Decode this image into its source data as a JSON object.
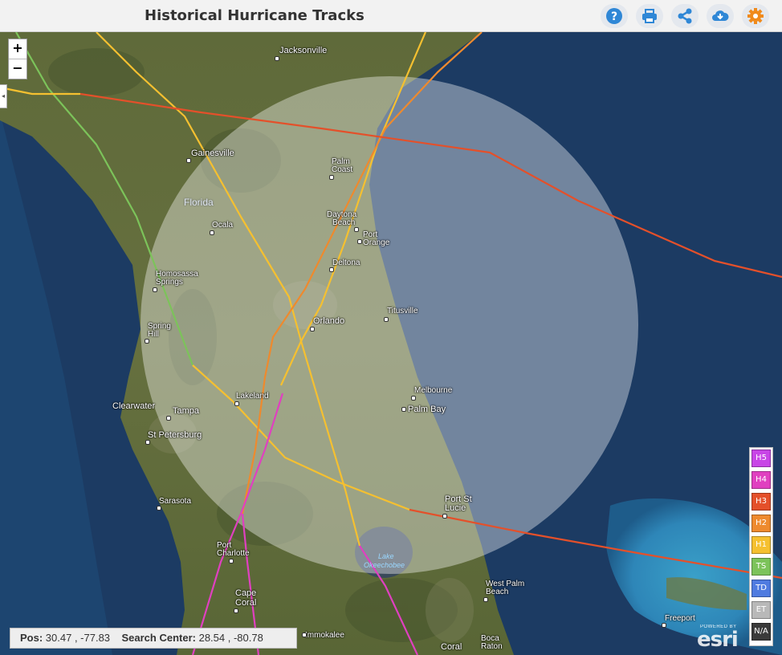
{
  "header": {
    "title": "Historical Hurricane Tracks"
  },
  "toolbar": [
    {
      "name": "help-icon",
      "color": "#2f87d6"
    },
    {
      "name": "print-icon",
      "color": "#2f87d6"
    },
    {
      "name": "share-icon",
      "color": "#2f87d6"
    },
    {
      "name": "download-icon",
      "color": "#2f87d6"
    },
    {
      "name": "gear-icon",
      "color": "#f08a1c"
    }
  ],
  "zoom": {
    "in": "+",
    "out": "−"
  },
  "labels": {
    "jacksonville": "Jacksonville",
    "gainesville": "Gainesville",
    "palm": "Palm",
    "coast": "Coast",
    "florida": "Florida",
    "daytona": "Daytona",
    "beach": "Beach",
    "port": "Port",
    "orange": "Orange",
    "ocala": "Ocala",
    "deltona": "Deltona",
    "homosassa": "Homosassa",
    "springs": "Springs",
    "titusville": "Titusville",
    "spring": "Spring",
    "hill": "Hill",
    "orlando": "Orlando",
    "melbourne": "Melbourne",
    "lakeland": "Lakeland",
    "clearwater": "Clearwater",
    "tampa": "Tampa",
    "palm_bay": "Palm Bay",
    "st_petersburg": "St Petersburg",
    "port_st": "Port St",
    "lucie": "Lucie",
    "sarasota": "Sarasota",
    "port2": "Port",
    "charlotte": "Charlotte",
    "lake": "Lake",
    "okeechobee": "Okeechobee",
    "west_palm": "West Palm",
    "beach2": "Beach",
    "cape": "Cape",
    "coral": "Coral",
    "immokalee": "Immokalee",
    "coral2": "Coral",
    "boca": "Boca",
    "raton": "Raton",
    "freeport": "Freeport"
  },
  "legend": [
    {
      "label": "H5",
      "color": "#c845e6"
    },
    {
      "label": "H4",
      "color": "#e040c0"
    },
    {
      "label": "H3",
      "color": "#e4502a"
    },
    {
      "label": "H2",
      "color": "#ee8a2e"
    },
    {
      "label": "H1",
      "color": "#f5c030"
    },
    {
      "label": "TS",
      "color": "#7cc35a"
    },
    {
      "label": "TD",
      "color": "#4f7be0"
    },
    {
      "label": "ET",
      "color": "#b8b8b8"
    },
    {
      "label": "N/A",
      "color": "#3a3a3a"
    }
  ],
  "status": {
    "pos_label": "Pos:",
    "pos_value": "30.47 , -77.83",
    "center_label": "Search Center:",
    "center_value": "28.54 , -80.78"
  },
  "attribution": {
    "powered": "POWERED BY",
    "logo": "esri"
  }
}
